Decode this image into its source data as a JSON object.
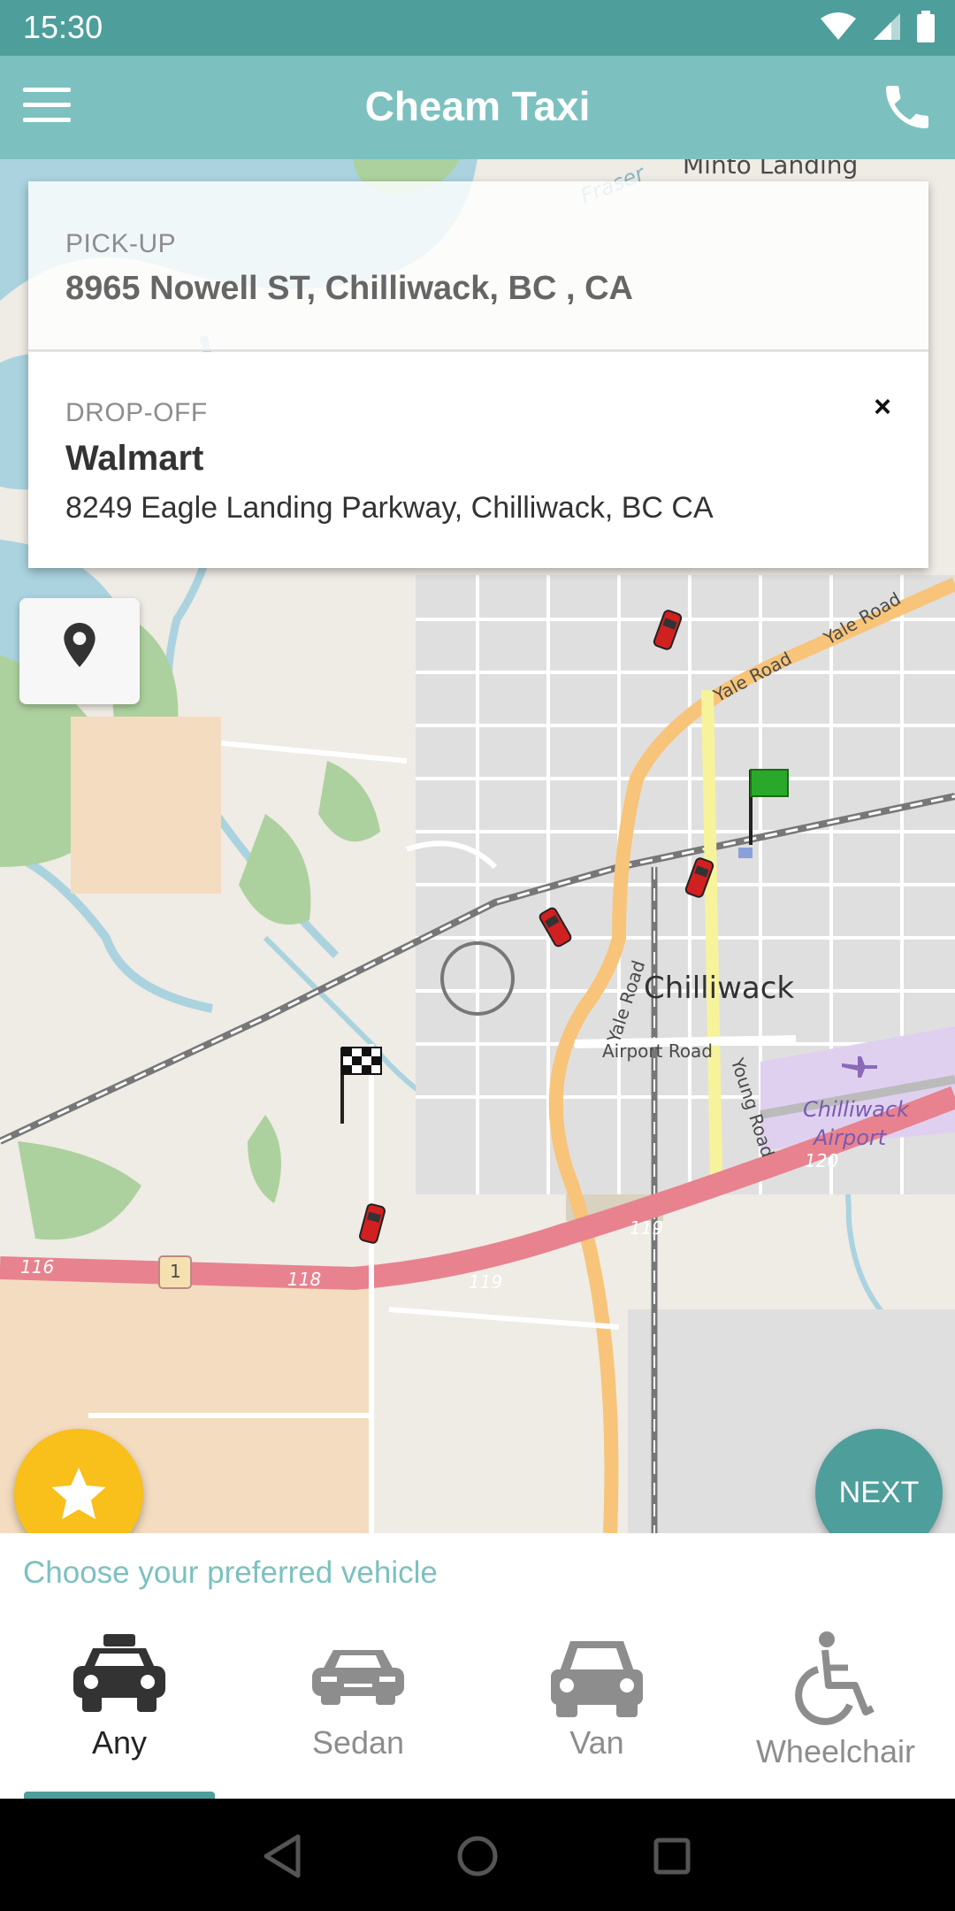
{
  "status_bar": {
    "time": "15:30"
  },
  "app_bar": {
    "title": "Cheam Taxi"
  },
  "pickup": {
    "caption": "PICK-UP",
    "address": "8965 Nowell ST, Chilliwack, BC , CA"
  },
  "dropoff": {
    "caption": "DROP-OFF",
    "name": "Walmart",
    "address": "8249 Eagle Landing Parkway, Chilliwack, BC CA",
    "clear_label": "×"
  },
  "map": {
    "labels": {
      "minto_landing": "Minto Landing",
      "fraser": "Fraser",
      "chilliwack": "Chilliwack",
      "yale_road": "Yale Road",
      "yale_road_2": "Yale Road",
      "yale_road_3": "Yale Road",
      "airport_road": "Airport Road",
      "young_road": "Young Road",
      "chilliwack_airport_1": "Chilliwack",
      "chilliwack_airport_2": "Airport",
      "exit_116": "116",
      "exit_118": "118",
      "exit_119a": "119",
      "exit_119b": "119",
      "exit_120": "120",
      "highway_1": "1"
    }
  },
  "actions": {
    "next_label": "NEXT"
  },
  "vehicle_panel": {
    "heading": "Choose your preferred vehicle",
    "options": [
      {
        "label": "Any",
        "icon": "taxi-icon",
        "selected": true
      },
      {
        "label": "Sedan",
        "icon": "sedan-icon",
        "selected": false
      },
      {
        "label": "Van",
        "icon": "van-icon",
        "selected": false
      },
      {
        "label": "Wheelchair",
        "icon": "wheelchair-icon",
        "selected": false
      }
    ]
  },
  "colors": {
    "primary": "#4e9e9c",
    "app_bar": "#7cc1bf",
    "accent": "#f9bf1a",
    "highway": "#e8828f",
    "major_road": "#f7c479"
  }
}
